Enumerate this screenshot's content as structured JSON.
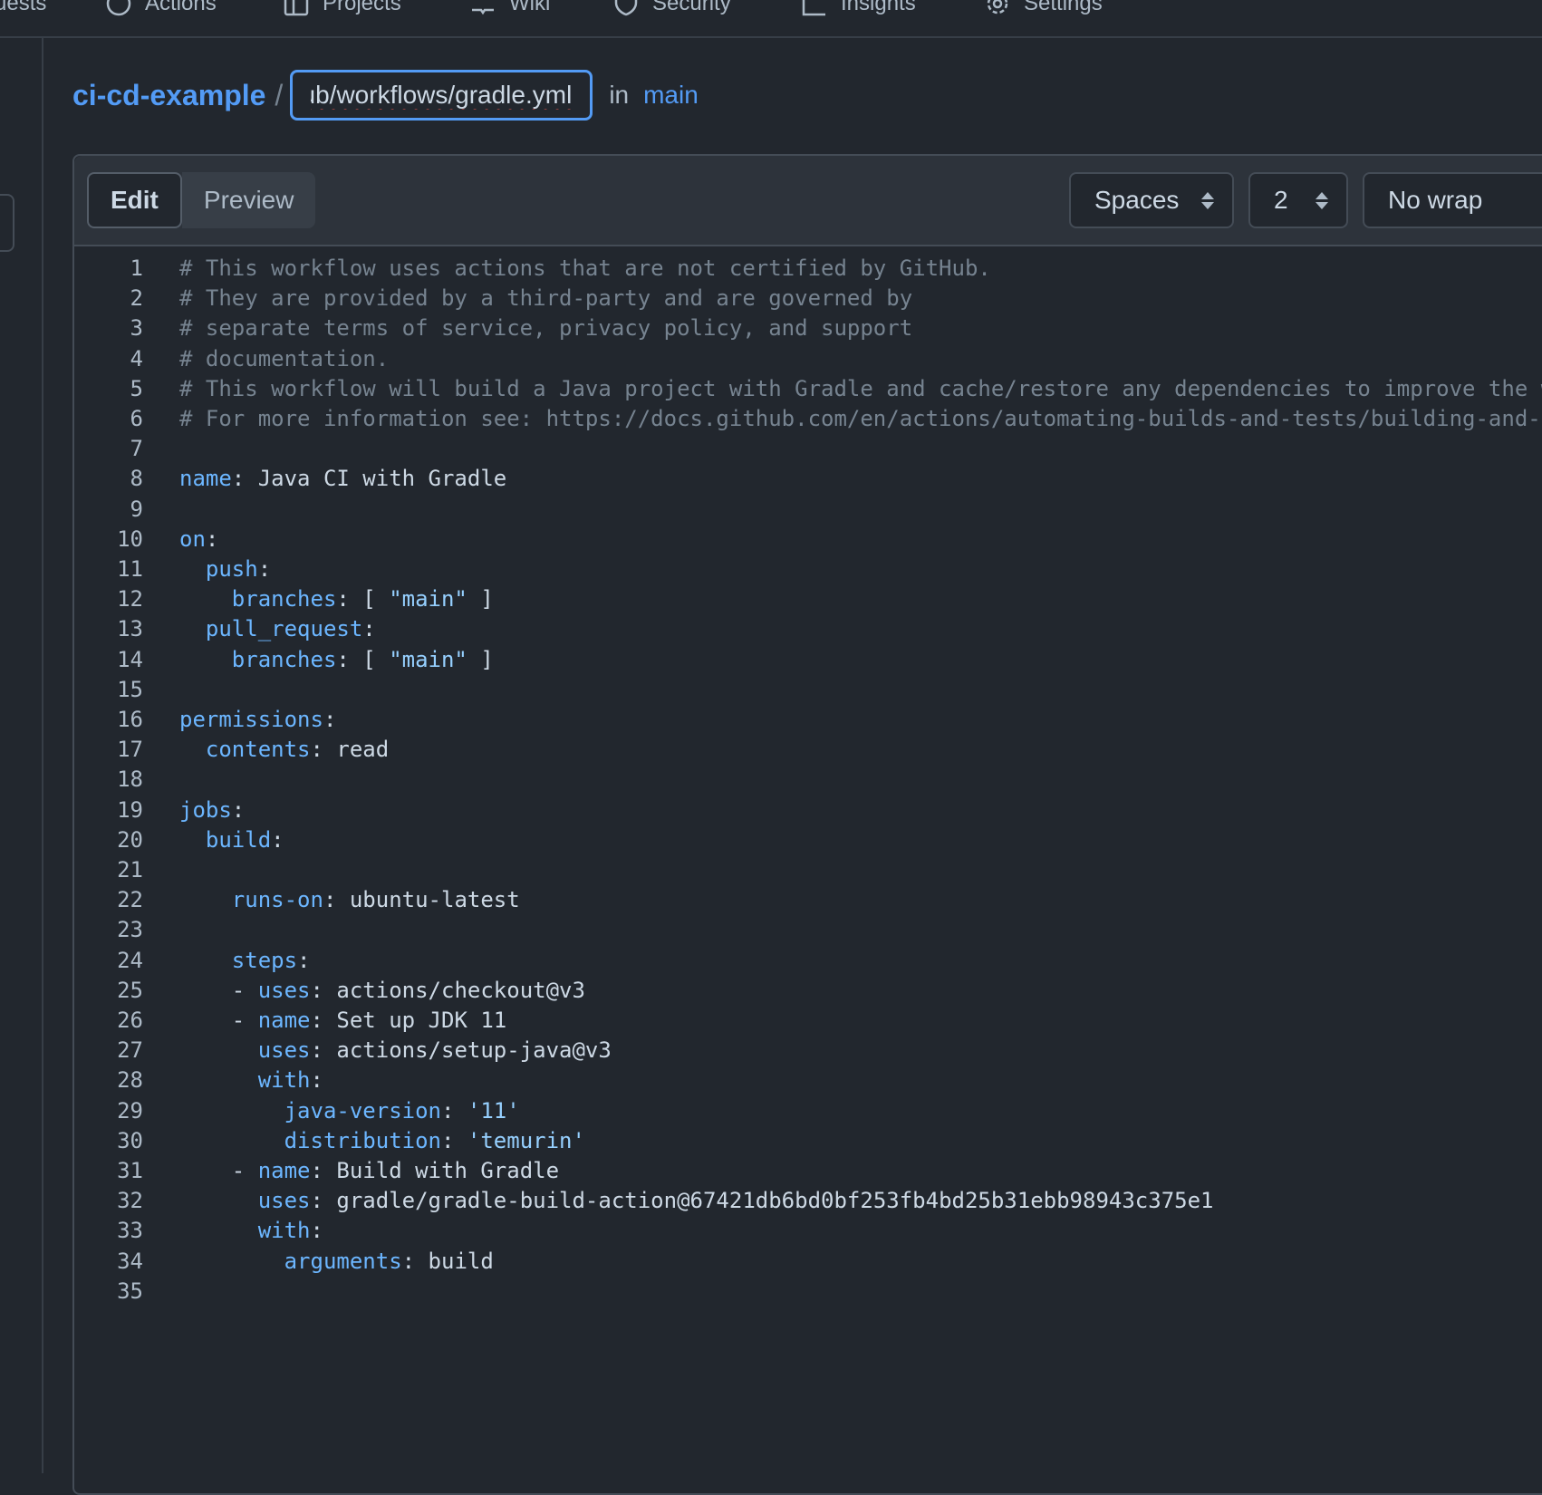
{
  "nav": {
    "tabs": [
      {
        "label": "uests",
        "icon": "none"
      },
      {
        "label": "Actions",
        "icon": "play-circle-icon"
      },
      {
        "label": "Projects",
        "icon": "table-icon"
      },
      {
        "label": "Wiki",
        "icon": "book-icon"
      },
      {
        "label": "Security",
        "icon": "shield-icon"
      },
      {
        "label": "Insights",
        "icon": "graph-icon"
      },
      {
        "label": "Settings",
        "icon": "gear-icon"
      }
    ]
  },
  "path": {
    "repo": "ci-cd-example",
    "separator": "/",
    "filename_value": "ub/workflows/gradle.yml",
    "in_label": "in",
    "branch": "main"
  },
  "toolbar": {
    "edit_label": "Edit",
    "preview_label": "Preview",
    "indent_mode": "Spaces",
    "indent_size": "2",
    "wrap_mode": "No wrap"
  },
  "colors": {
    "accent": "#539bf5",
    "background": "#22272e",
    "key": "#6cb6ff",
    "comment": "#768390"
  },
  "code_lines": [
    [
      {
        "t": "# This workflow uses actions that are not certified by GitHub.",
        "c": "c"
      }
    ],
    [
      {
        "t": "# They are provided by a third-party and are governed by",
        "c": "c"
      }
    ],
    [
      {
        "t": "# separate terms of service, privacy policy, and support",
        "c": "c"
      }
    ],
    [
      {
        "t": "# documentation.",
        "c": "c"
      }
    ],
    [
      {
        "t": "# This workflow will build a Java project with Gradle and cache/restore any dependencies to improve the w",
        "c": "c"
      }
    ],
    [
      {
        "t": "# For more information see: https://docs.github.com/en/actions/automating-builds-and-tests/building-and-t",
        "c": "c"
      }
    ],
    [],
    [
      {
        "t": "name",
        "c": "k"
      },
      {
        "t": ": Java CI with Gradle",
        "c": ""
      }
    ],
    [],
    [
      {
        "t": "on",
        "c": "k"
      },
      {
        "t": ":",
        "c": ""
      }
    ],
    [
      {
        "t": "  ",
        "c": ""
      },
      {
        "t": "push",
        "c": "k"
      },
      {
        "t": ":",
        "c": ""
      }
    ],
    [
      {
        "t": "    ",
        "c": ""
      },
      {
        "t": "branches",
        "c": "k"
      },
      {
        "t": ": [ ",
        "c": ""
      },
      {
        "t": "\"main\"",
        "c": "s"
      },
      {
        "t": " ]",
        "c": ""
      }
    ],
    [
      {
        "t": "  ",
        "c": ""
      },
      {
        "t": "pull_request",
        "c": "k"
      },
      {
        "t": ":",
        "c": ""
      }
    ],
    [
      {
        "t": "    ",
        "c": ""
      },
      {
        "t": "branches",
        "c": "k"
      },
      {
        "t": ": [ ",
        "c": ""
      },
      {
        "t": "\"main\"",
        "c": "s"
      },
      {
        "t": " ]",
        "c": ""
      }
    ],
    [],
    [
      {
        "t": "permissions",
        "c": "k"
      },
      {
        "t": ":",
        "c": ""
      }
    ],
    [
      {
        "t": "  ",
        "c": ""
      },
      {
        "t": "contents",
        "c": "k"
      },
      {
        "t": ": read",
        "c": ""
      }
    ],
    [],
    [
      {
        "t": "jobs",
        "c": "k"
      },
      {
        "t": ":",
        "c": ""
      }
    ],
    [
      {
        "t": "  ",
        "c": ""
      },
      {
        "t": "build",
        "c": "k"
      },
      {
        "t": ":",
        "c": ""
      }
    ],
    [],
    [
      {
        "t": "    ",
        "c": ""
      },
      {
        "t": "runs-on",
        "c": "k"
      },
      {
        "t": ": ubuntu-latest",
        "c": ""
      }
    ],
    [],
    [
      {
        "t": "    ",
        "c": ""
      },
      {
        "t": "steps",
        "c": "k"
      },
      {
        "t": ":",
        "c": ""
      }
    ],
    [
      {
        "t": "    - ",
        "c": ""
      },
      {
        "t": "uses",
        "c": "k"
      },
      {
        "t": ": actions/checkout@v3",
        "c": ""
      }
    ],
    [
      {
        "t": "    - ",
        "c": ""
      },
      {
        "t": "name",
        "c": "k"
      },
      {
        "t": ": Set up JDK 11",
        "c": ""
      }
    ],
    [
      {
        "t": "      ",
        "c": ""
      },
      {
        "t": "uses",
        "c": "k"
      },
      {
        "t": ": actions/setup-java@v3",
        "c": ""
      }
    ],
    [
      {
        "t": "      ",
        "c": ""
      },
      {
        "t": "with",
        "c": "k"
      },
      {
        "t": ":",
        "c": ""
      }
    ],
    [
      {
        "t": "        ",
        "c": ""
      },
      {
        "t": "java-version",
        "c": "k"
      },
      {
        "t": ": ",
        "c": ""
      },
      {
        "t": "'11'",
        "c": "s"
      }
    ],
    [
      {
        "t": "        ",
        "c": ""
      },
      {
        "t": "distribution",
        "c": "k"
      },
      {
        "t": ": ",
        "c": ""
      },
      {
        "t": "'temurin'",
        "c": "s"
      }
    ],
    [
      {
        "t": "    - ",
        "c": ""
      },
      {
        "t": "name",
        "c": "k"
      },
      {
        "t": ": Build with Gradle",
        "c": ""
      }
    ],
    [
      {
        "t": "      ",
        "c": ""
      },
      {
        "t": "uses",
        "c": "k"
      },
      {
        "t": ": gradle/gradle-build-action@67421db6bd0bf253fb4bd25b31ebb98943c375e1",
        "c": ""
      }
    ],
    [
      {
        "t": "      ",
        "c": ""
      },
      {
        "t": "with",
        "c": "k"
      },
      {
        "t": ":",
        "c": ""
      }
    ],
    [
      {
        "t": "        ",
        "c": ""
      },
      {
        "t": "arguments",
        "c": "k"
      },
      {
        "t": ": build",
        "c": ""
      }
    ],
    []
  ]
}
